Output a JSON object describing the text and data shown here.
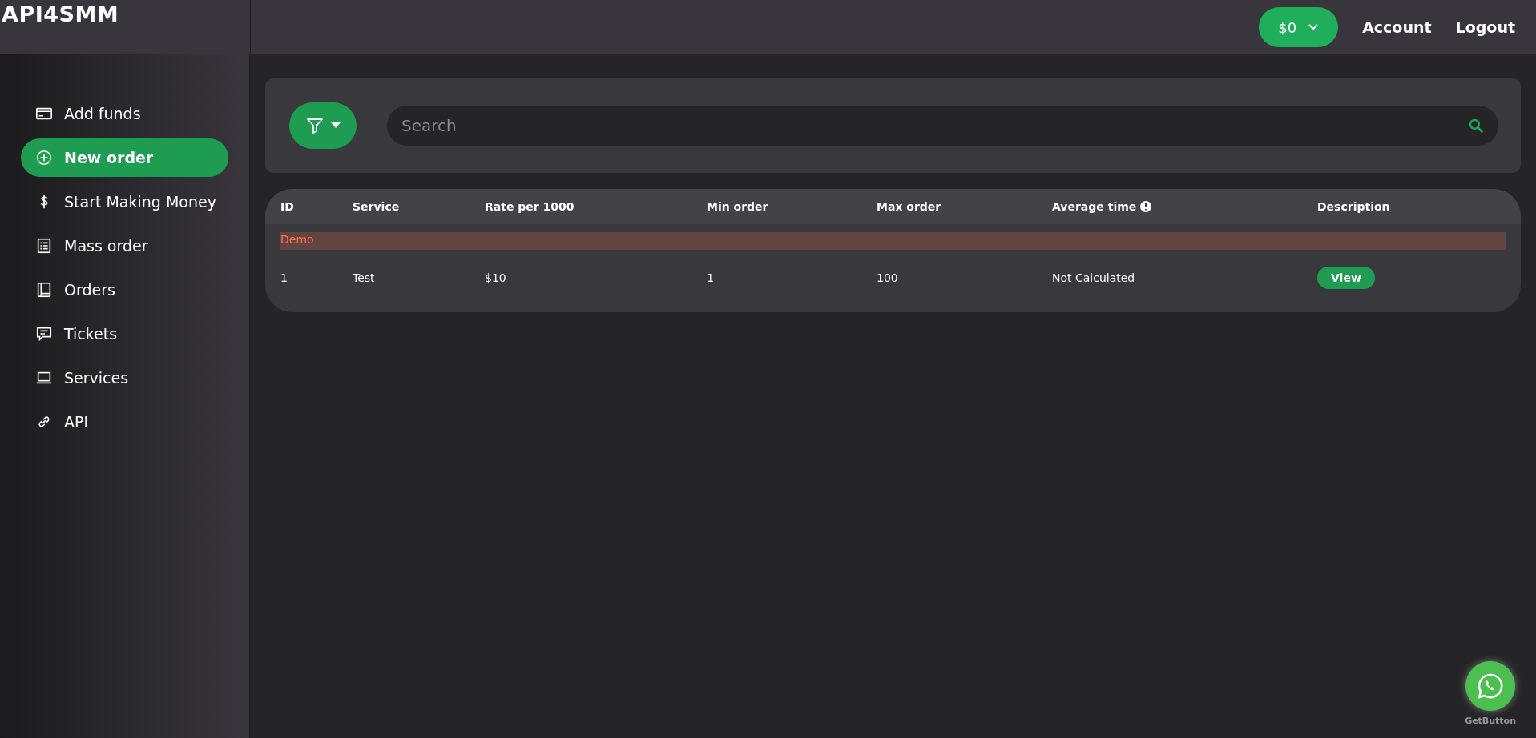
{
  "brand": "API4SMM",
  "header": {
    "balance": "$0",
    "links": [
      "Account",
      "Logout"
    ]
  },
  "sidebar": {
    "items": [
      {
        "label": "Add funds",
        "kind": "card",
        "selected": false
      },
      {
        "label": "New order",
        "kind": "plus",
        "selected": true
      },
      {
        "label": "Start Making Money",
        "kind": "dollar",
        "selected": false
      },
      {
        "label": "Mass order",
        "kind": "list",
        "selected": false
      },
      {
        "label": "Orders",
        "kind": "book",
        "selected": false
      },
      {
        "label": "Tickets",
        "kind": "chat",
        "selected": false
      },
      {
        "label": "Services",
        "kind": "laptop",
        "selected": false
      },
      {
        "label": "API",
        "kind": "link",
        "selected": false
      }
    ]
  },
  "search": {
    "placeholder": "Search"
  },
  "table": {
    "columns": [
      "ID",
      "Service",
      "Rate per 1000",
      "Min order",
      "Max order",
      "Average time",
      "Description"
    ],
    "groups": [
      {
        "name": "Demo",
        "rows": [
          {
            "cells": [
              "1",
              "Test",
              "$10",
              "1",
              "100",
              "Not Calculated"
            ],
            "action": "View"
          }
        ]
      }
    ]
  },
  "widget": {
    "caption": "GetButton"
  }
}
